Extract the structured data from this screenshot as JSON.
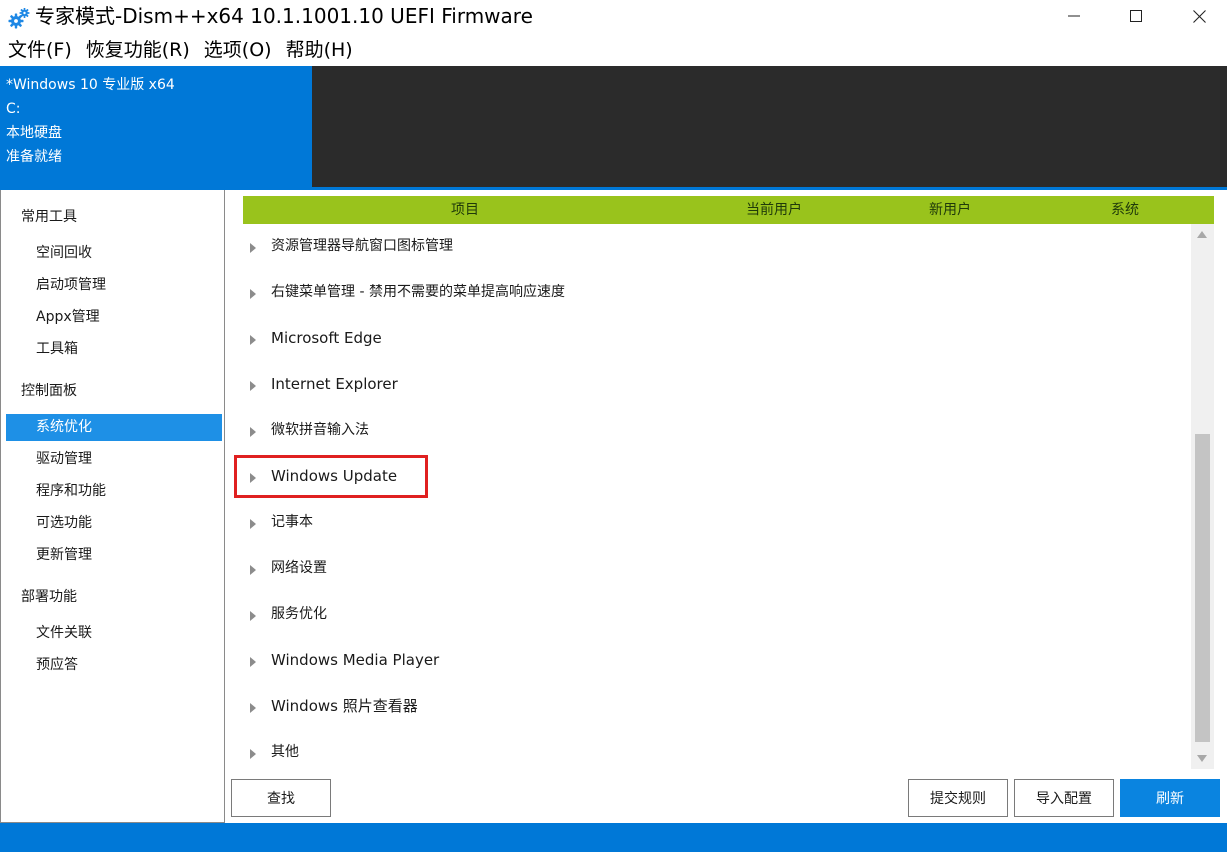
{
  "window": {
    "title": "专家模式-Dism++x64 10.1.1001.10 UEFI Firmware",
    "controls": [
      "minimize",
      "maximize",
      "close"
    ]
  },
  "menu": [
    "文件(F)",
    "恢复功能(R)",
    "选项(O)",
    "帮助(H)"
  ],
  "info": {
    "os": "*Windows 10 专业版 x64",
    "drive": "C:",
    "disk_type": "本地硬盘",
    "status": "准备就绪"
  },
  "sidebar": {
    "groups": [
      {
        "label": "常用工具",
        "items": [
          "空间回收",
          "启动项管理",
          "Appx管理",
          "工具箱"
        ]
      },
      {
        "label": "控制面板",
        "items": [
          "系统优化",
          "驱动管理",
          "程序和功能",
          "可选功能",
          "更新管理"
        ]
      },
      {
        "label": "部署功能",
        "items": [
          "文件关联",
          "预应答"
        ]
      }
    ],
    "selected": "系统优化"
  },
  "table": {
    "columns": [
      "项目",
      "当前用户",
      "新用户",
      "系统"
    ],
    "rows": [
      "资源管理器导航窗口图标管理",
      "右键菜单管理 - 禁用不需要的菜单提高响应速度",
      "Microsoft Edge",
      "Internet Explorer",
      "微软拼音输入法",
      "Windows Update",
      "记事本",
      "网络设置",
      "服务优化",
      "Windows Media Player",
      "Windows 照片查看器",
      "其他"
    ],
    "highlighted_row": "Windows Update"
  },
  "buttons": {
    "find": "查找",
    "submit_rules": "提交规则",
    "import_config": "导入配置",
    "refresh": "刷新"
  },
  "colors": {
    "accent_blue": "#0078d7",
    "header_green": "#99c31c",
    "selection_blue": "#1e90e6",
    "highlight_red": "#e02020",
    "dark_panel": "#2b2b2b"
  }
}
